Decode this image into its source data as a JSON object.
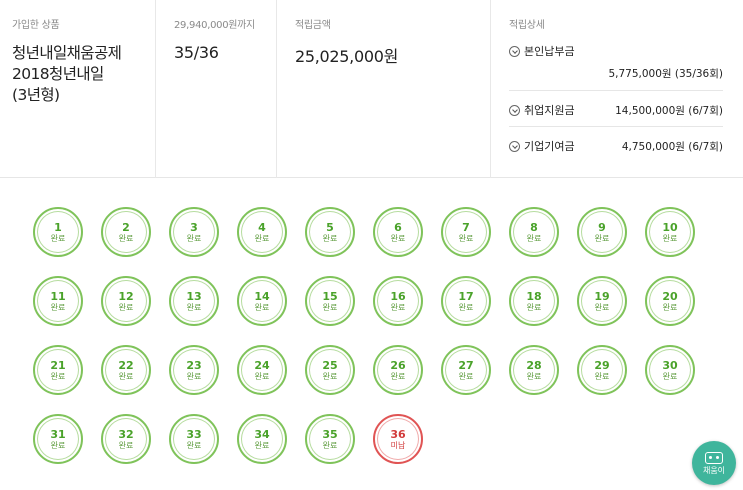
{
  "summary": {
    "product": {
      "caption": "가입한 상품",
      "name_line1": "청년내일채움공제",
      "name_line2": "2018청년내일",
      "name_line3": "(3년형)"
    },
    "target": {
      "caption": "29,940,000원까지",
      "value": "35/36"
    },
    "amount": {
      "caption": "적립금액",
      "value": "25,025,000원"
    },
    "detail": {
      "caption": "적립상세",
      "rows": [
        {
          "label": "본인납부금",
          "value": "5,775,000원 (35/36회)"
        },
        {
          "label": "취업지원금",
          "value": "14,500,000원 (6/7회)"
        },
        {
          "label": "기업기여금",
          "value": "4,750,000원 (6/7회)"
        }
      ]
    }
  },
  "payments": [
    {
      "n": "1",
      "status": "완료"
    },
    {
      "n": "2",
      "status": "완료"
    },
    {
      "n": "3",
      "status": "완료"
    },
    {
      "n": "4",
      "status": "완료"
    },
    {
      "n": "5",
      "status": "완료"
    },
    {
      "n": "6",
      "status": "완료"
    },
    {
      "n": "7",
      "status": "완료"
    },
    {
      "n": "8",
      "status": "완료"
    },
    {
      "n": "9",
      "status": "완료"
    },
    {
      "n": "10",
      "status": "완료"
    },
    {
      "n": "11",
      "status": "완료"
    },
    {
      "n": "12",
      "status": "완료"
    },
    {
      "n": "13",
      "status": "완료"
    },
    {
      "n": "14",
      "status": "완료"
    },
    {
      "n": "15",
      "status": "완료"
    },
    {
      "n": "16",
      "status": "완료"
    },
    {
      "n": "17",
      "status": "완료"
    },
    {
      "n": "18",
      "status": "완료"
    },
    {
      "n": "19",
      "status": "완료"
    },
    {
      "n": "20",
      "status": "완료"
    },
    {
      "n": "21",
      "status": "완료"
    },
    {
      "n": "22",
      "status": "완료"
    },
    {
      "n": "23",
      "status": "완료"
    },
    {
      "n": "24",
      "status": "완료"
    },
    {
      "n": "25",
      "status": "완료"
    },
    {
      "n": "26",
      "status": "완료"
    },
    {
      "n": "27",
      "status": "완료"
    },
    {
      "n": "28",
      "status": "완료"
    },
    {
      "n": "29",
      "status": "완료"
    },
    {
      "n": "30",
      "status": "완료"
    },
    {
      "n": "31",
      "status": "완료"
    },
    {
      "n": "32",
      "status": "완료"
    },
    {
      "n": "33",
      "status": "완료"
    },
    {
      "n": "34",
      "status": "완료"
    },
    {
      "n": "35",
      "status": "완료"
    },
    {
      "n": "36",
      "status": "미납"
    }
  ],
  "colors": {
    "complete": "#7fc35a",
    "unpaid": "#e05454",
    "chatbot": "#3fb59c"
  },
  "chatbot": {
    "label": "채움이",
    "icon": "robot-icon"
  }
}
